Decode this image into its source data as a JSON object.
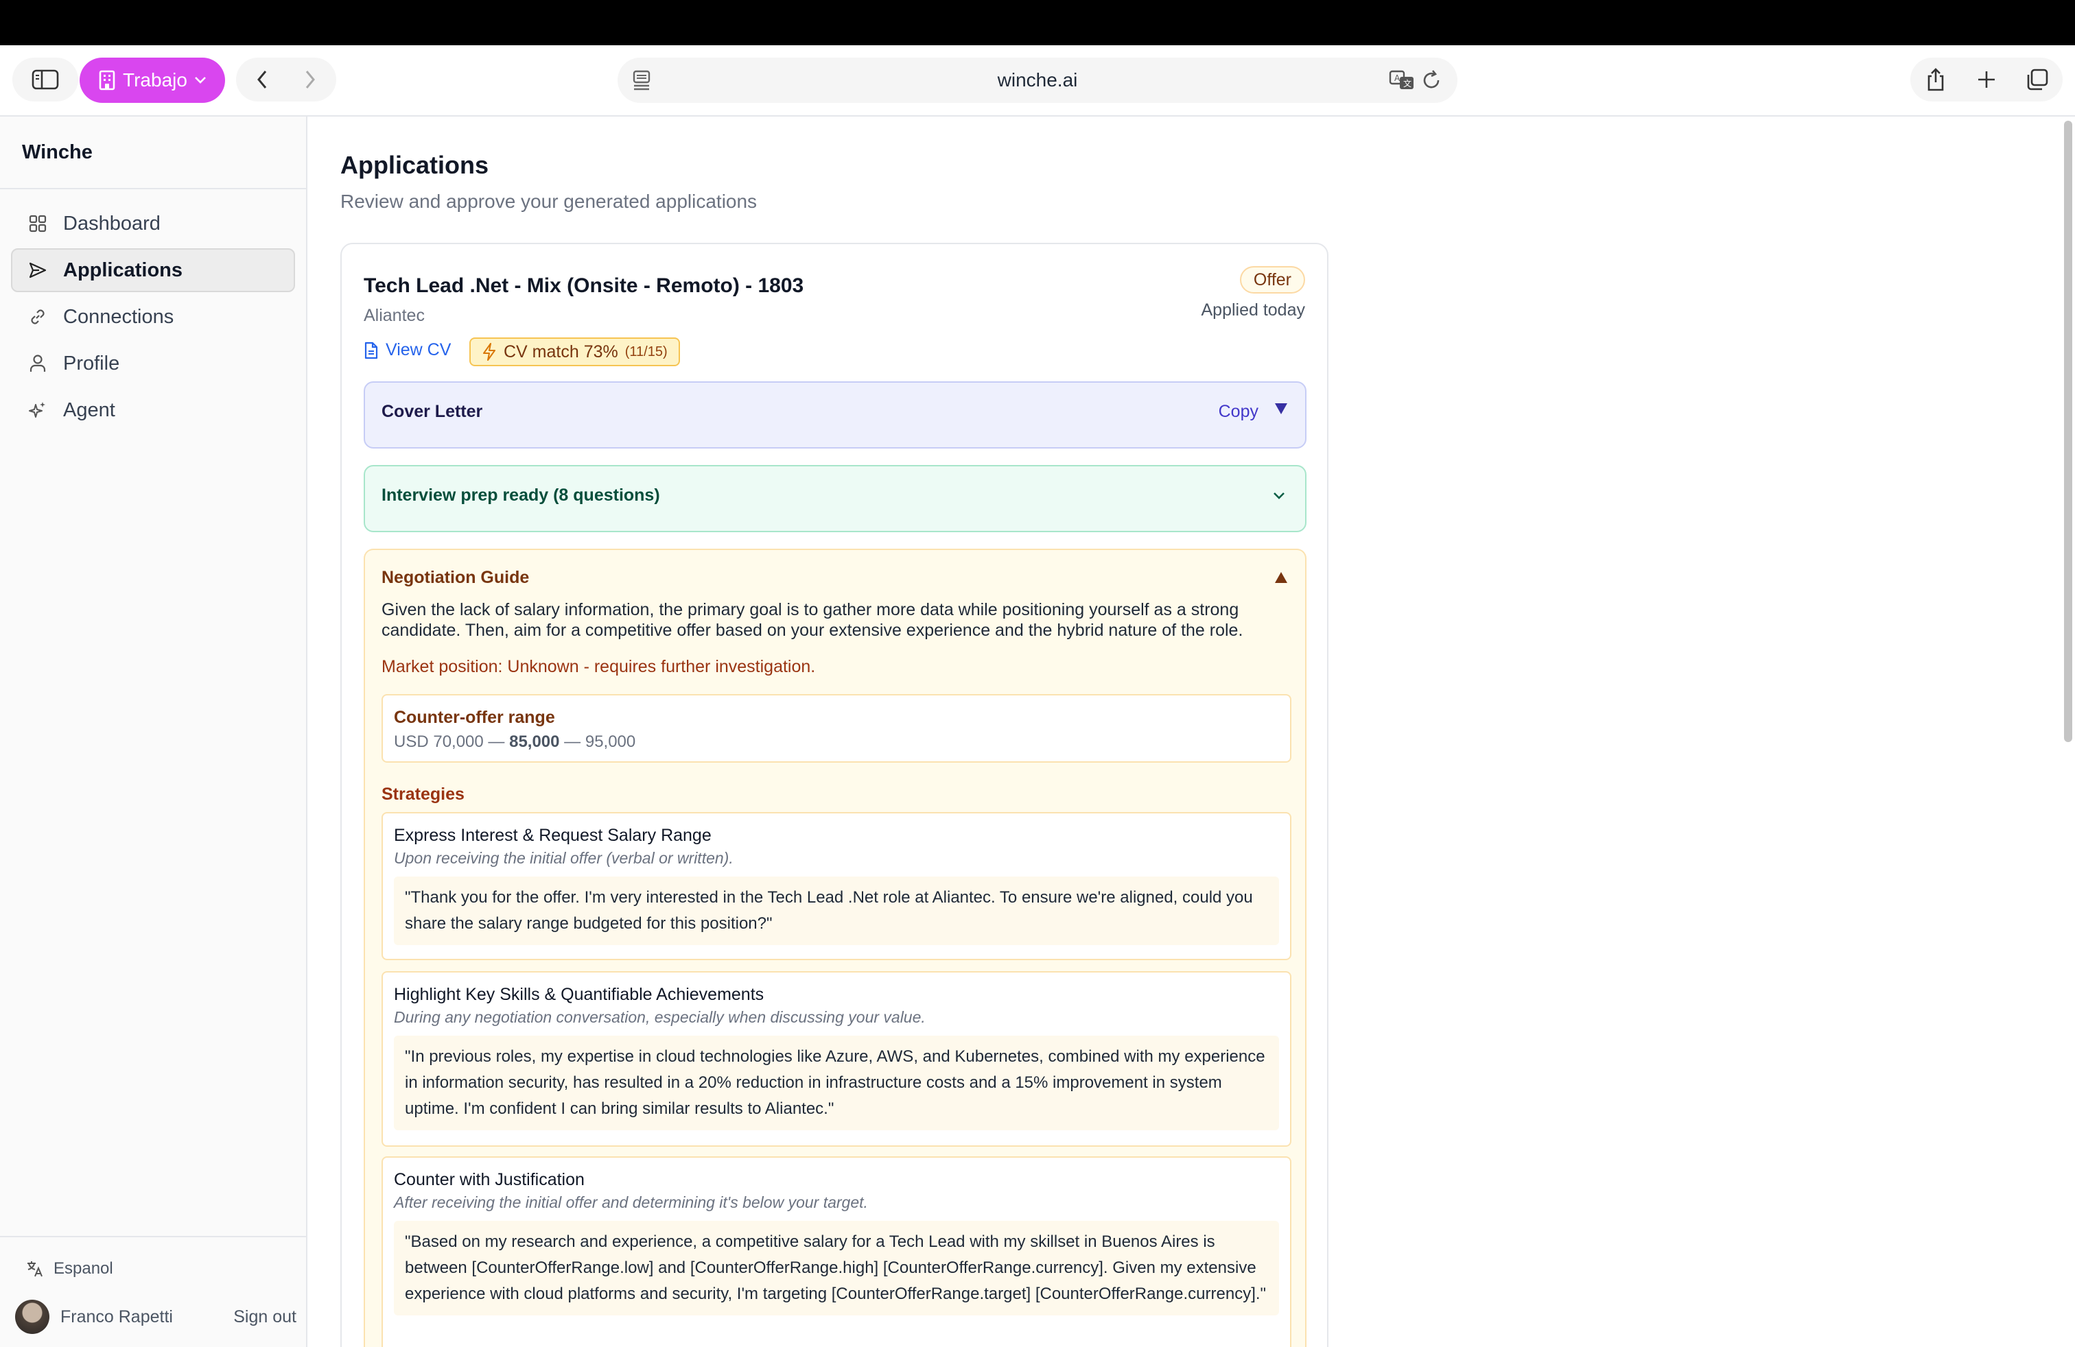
{
  "browser": {
    "profile_label": "Trabajo",
    "url": "winche.ai"
  },
  "sidebar": {
    "brand": "Winche",
    "items": [
      {
        "label": "Dashboard",
        "icon": "grid-icon"
      },
      {
        "label": "Applications",
        "icon": "send-icon",
        "active": true
      },
      {
        "label": "Connections",
        "icon": "link-icon"
      },
      {
        "label": "Profile",
        "icon": "user-icon"
      },
      {
        "label": "Agent",
        "icon": "sparkles-icon"
      }
    ],
    "language": "Espanol",
    "user_name": "Franco Rapetti",
    "signout": "Sign out"
  },
  "page": {
    "title": "Applications",
    "subtitle": "Review and approve your generated applications"
  },
  "application": {
    "job_title": "Tech Lead .Net - Mix (Onsite - Remoto) - 1803",
    "company": "Aliantec",
    "status": "Offer",
    "applied": "Applied today",
    "view_cv": "View CV",
    "cv_match": "CV match 73%",
    "cv_match_count": "(11/15)",
    "cover_letter": {
      "title": "Cover Letter",
      "copy": "Copy"
    },
    "interview": {
      "title": "Interview prep ready (8 questions)"
    },
    "negotiation": {
      "title": "Negotiation Guide",
      "intro": "Given the lack of salary information, the primary goal is to gather more data while positioning yourself as a strong candidate. Then, aim for a competitive offer based on your extensive experience and the hybrid nature of the role.",
      "market": "Market position: Unknown - requires further investigation.",
      "counter_label": "Counter-offer range",
      "counter_low": "USD 70,000",
      "counter_target": "85,000",
      "counter_high": "95,000",
      "sep": " — ",
      "strategies_label": "Strategies",
      "strategies": [
        {
          "title": "Express Interest & Request Salary Range",
          "when": "Upon receiving the initial offer (verbal or written).",
          "quote": "\"Thank you for the offer. I'm very interested in the Tech Lead .Net role at Aliantec. To ensure we're aligned, could you share the salary range budgeted for this position?\""
        },
        {
          "title": "Highlight Key Skills & Quantifiable Achievements",
          "when": "During any negotiation conversation, especially when discussing your value.",
          "quote": "\"In previous roles, my expertise in cloud technologies like Azure, AWS, and Kubernetes, combined with my experience in information security, has resulted in a 20% reduction in infrastructure costs and a 15% improvement in system uptime. I'm confident I can bring similar results to Aliantec.\""
        },
        {
          "title": "Counter with Justification",
          "when": "After receiving the initial offer and determining it's below your target.",
          "quote": "\"Based on my research and experience, a competitive salary for a Tech Lead with my skillset in Buenos Aires is between [CounterOfferRange.low] and [CounterOfferRange.high] [CounterOfferRange.currency]. Given my extensive experience with cloud platforms and security, I'm targeting [CounterOfferRange.target] [CounterOfferRange.currency].\""
        }
      ]
    }
  },
  "colors": {
    "profile_pill": "#d946ef",
    "link": "#2563eb",
    "offer_badge_bg": "#fffbeb",
    "cover_bg": "#eef0fd",
    "interview_bg": "#edfbf5",
    "negotiation_bg": "#fffbeb"
  }
}
